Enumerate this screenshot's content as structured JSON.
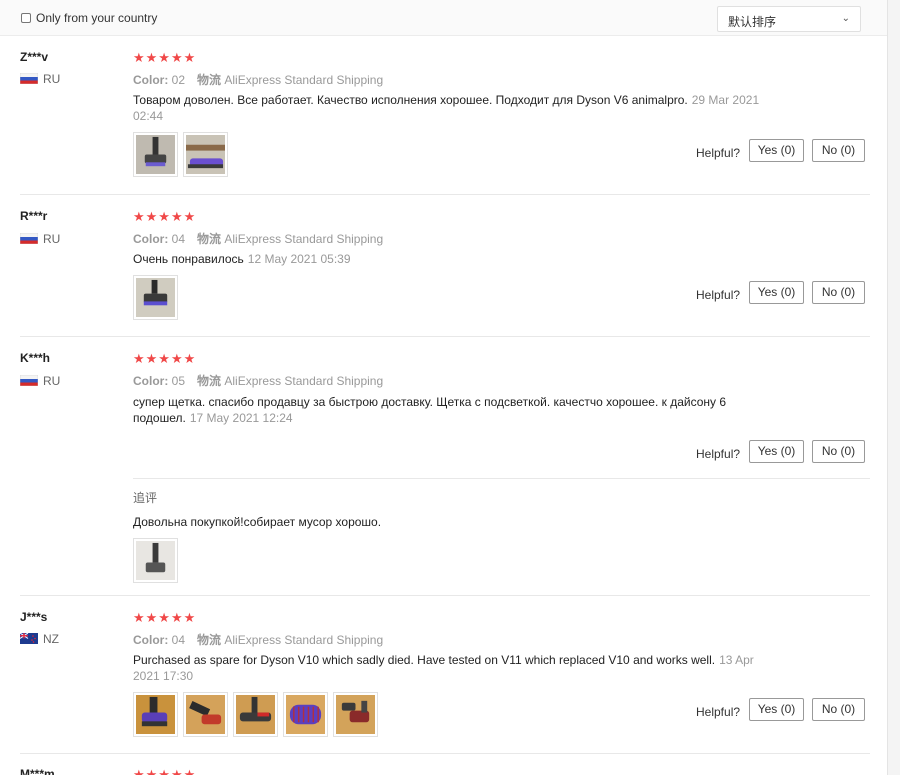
{
  "filter": {
    "only_country_label": "Only from your country",
    "sort_value": "默认排序"
  },
  "common": {
    "helpful_label": "Helpful?",
    "color_label": "Color:",
    "shipping_label": "物流",
    "followup_label": "追评"
  },
  "reviews": [
    {
      "user": "Z***v",
      "country": "RU",
      "rating": "★★★★★",
      "color": "02",
      "shipping": "AliExpress Standard Shipping",
      "text": "Товаром доволен. Все работает. Качество исполнения хорошее. Подходит для Dyson V6 animalpro.",
      "date": "29 Mar 2021 02:44",
      "yes": "Yes (0)",
      "no": "No (0)"
    },
    {
      "user": "R***r",
      "country": "RU",
      "rating": "★★★★★",
      "color": "04",
      "shipping": "AliExpress Standard Shipping",
      "text": "Очень понравилось",
      "date": "12 May 2021 05:39",
      "yes": "Yes (0)",
      "no": "No (0)"
    },
    {
      "user": "K***h",
      "country": "RU",
      "rating": "★★★★★",
      "color": "05",
      "shipping": "AliExpress Standard Shipping",
      "text": "супер щетка. спасибо продавцу за быстрою доставку. Щетка с подсветкой. качестчо хорошее. к дайсону 6 подошел.",
      "date": "17 May 2021 12:24",
      "yes": "Yes (0)",
      "no": "No (0)",
      "followup_text": "Довольна покупкой!собирает мусор хорошо."
    },
    {
      "user": "J***s",
      "country": "NZ",
      "rating": "★★★★★",
      "color": "04",
      "shipping": "AliExpress Standard Shipping",
      "text": "Purchased as spare for Dyson V10 which sadly died. Have tested on V11 which replaced V10 and works well.",
      "date": "13 Apr 2021 17:30",
      "yes": "Yes (0)",
      "no": "No (0)"
    },
    {
      "user": "M***m",
      "rating": "★★★★★"
    }
  ]
}
